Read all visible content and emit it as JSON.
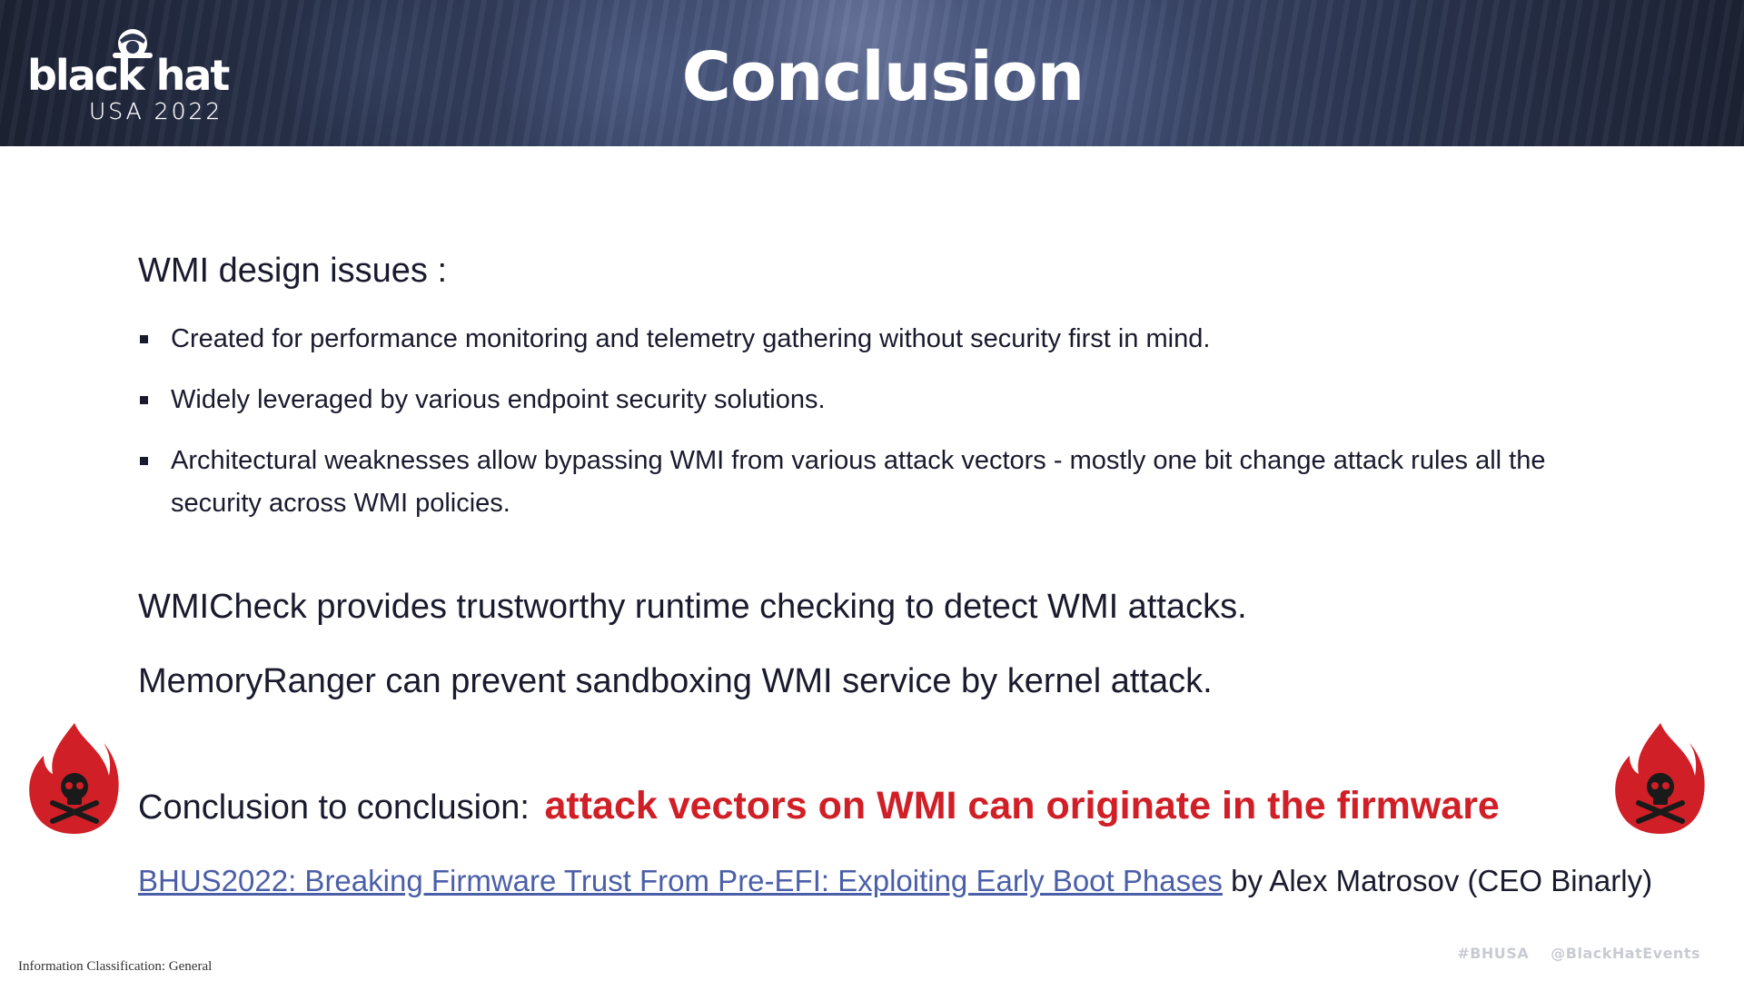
{
  "header": {
    "logo": {
      "brand": "black hat",
      "event": "USA 2022"
    },
    "title": "Conclusion"
  },
  "body": {
    "section_heading": "WMI design issues :",
    "bullets": [
      "Created for performance monitoring and telemetry gathering without security first in mind.",
      "Widely leveraged by various endpoint security solutions.",
      "Architectural weaknesses allow bypassing WMI from various attack vectors - mostly one bit change attack rules all the security across WMI policies."
    ],
    "statements": [
      "WMICheck provides trustworthy runtime checking to detect WMI attacks.",
      "MemoryRanger can prevent sandboxing WMI service by kernel attack."
    ],
    "conclusion": {
      "prefix": "Conclusion to conclusion:",
      "emphasis": "attack vectors on WMI can originate in the firmware"
    },
    "reference": {
      "link_text": "BHUS2022: Breaking Firmware Trust From Pre-EFI: Exploiting Early Boot Phases",
      "suffix": "by Alex Matrosov (CEO Binarly)"
    },
    "icons": {
      "left": "skull-flame-icon",
      "right": "skull-flame-icon"
    }
  },
  "footer": {
    "classification": "Information Classification: General",
    "hashtag": "#BHUSA",
    "handle": "@BlackHatEvents"
  },
  "colors": {
    "header_bg": "#2b3550",
    "emphasis_red": "#d01f26",
    "link_blue": "#4a5fa8",
    "text_dark": "#1a1a2e"
  }
}
